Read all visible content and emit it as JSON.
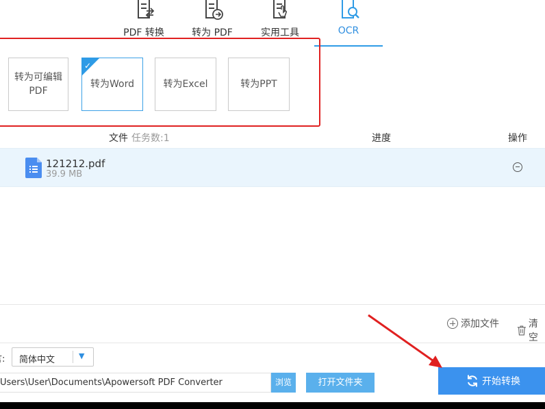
{
  "toolbar": {
    "tabs": [
      {
        "label": "PDF 转换",
        "icon": "pdf-convert-icon"
      },
      {
        "label": "转为 PDF",
        "icon": "to-pdf-icon"
      },
      {
        "label": "实用工具",
        "icon": "tools-icon"
      },
      {
        "label": "OCR",
        "icon": "ocr-icon",
        "active": true
      }
    ]
  },
  "options": [
    {
      "label_line1": "转为可编辑",
      "label_line2": "PDF"
    },
    {
      "label": "转为Word",
      "selected": true
    },
    {
      "label": "转为Excel"
    },
    {
      "label": "转为PPT"
    }
  ],
  "list": {
    "header_file": "文件",
    "header_tasks": "任务数:1",
    "header_progress": "进度",
    "header_action": "操作",
    "rows": [
      {
        "name": "121212.pdf",
        "size": "39.9 MB"
      }
    ]
  },
  "actions": {
    "add_file": "添加文件",
    "clear": "清空"
  },
  "language": {
    "label_partial": "言:",
    "selected": "简体中文"
  },
  "output": {
    "path": "Users\\User\\Documents\\Apowersoft PDF Converter",
    "browse": "浏览",
    "open_folder": "打开文件夹"
  },
  "start_button": "开始转换",
  "colors": {
    "accent": "#2e9be6",
    "button_blue": "#3b92ee",
    "highlight_red": "#e02020",
    "row_bg": "#eaf5fd"
  }
}
